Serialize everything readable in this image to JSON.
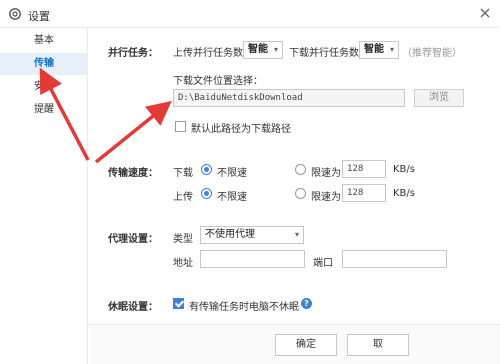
{
  "window": {
    "title": "设置"
  },
  "sidebar": {
    "items": [
      {
        "label": "基本",
        "active": false
      },
      {
        "label": "传输",
        "active": true
      },
      {
        "label": "安全",
        "active": false
      },
      {
        "label": "提醒",
        "active": false
      }
    ]
  },
  "parallel": {
    "section_label": "并行任务：",
    "upload_label": "上传并行任务数",
    "upload_value": "智能",
    "download_label": "下载并行任务数",
    "download_value": "智能",
    "hint": "（推荐智能）"
  },
  "download_location": {
    "label": "下载文件位置选择：",
    "path": "D:\\BaiduNetdiskDownload",
    "browse_label": "浏览",
    "default_checkbox_label": "默认此路径为下载路径",
    "default_checked": false
  },
  "speed": {
    "section_label": "传输速度：",
    "download_label": "下载",
    "upload_label": "上传",
    "unlimited_label": "不限速",
    "limit_label": "限速为",
    "download_limit_value": "128",
    "upload_limit_value": "128",
    "unit": "KB/s"
  },
  "proxy": {
    "section_label": "代理设置：",
    "type_label": "类型",
    "type_value": "不使用代理",
    "address_label": "地址",
    "port_label": "端口",
    "address_value": "",
    "port_value": ""
  },
  "sleep": {
    "section_label": "休眠设置：",
    "checkbox_label": "有传输任务时电脑不休眠",
    "checked": true,
    "help": "?"
  },
  "footer": {
    "ok_label": "确定",
    "cancel_label": "取"
  },
  "colors": {
    "accent": "#3c84d8",
    "annotation_arrow": "#e53935",
    "active_bg": "#e6f0fb"
  }
}
